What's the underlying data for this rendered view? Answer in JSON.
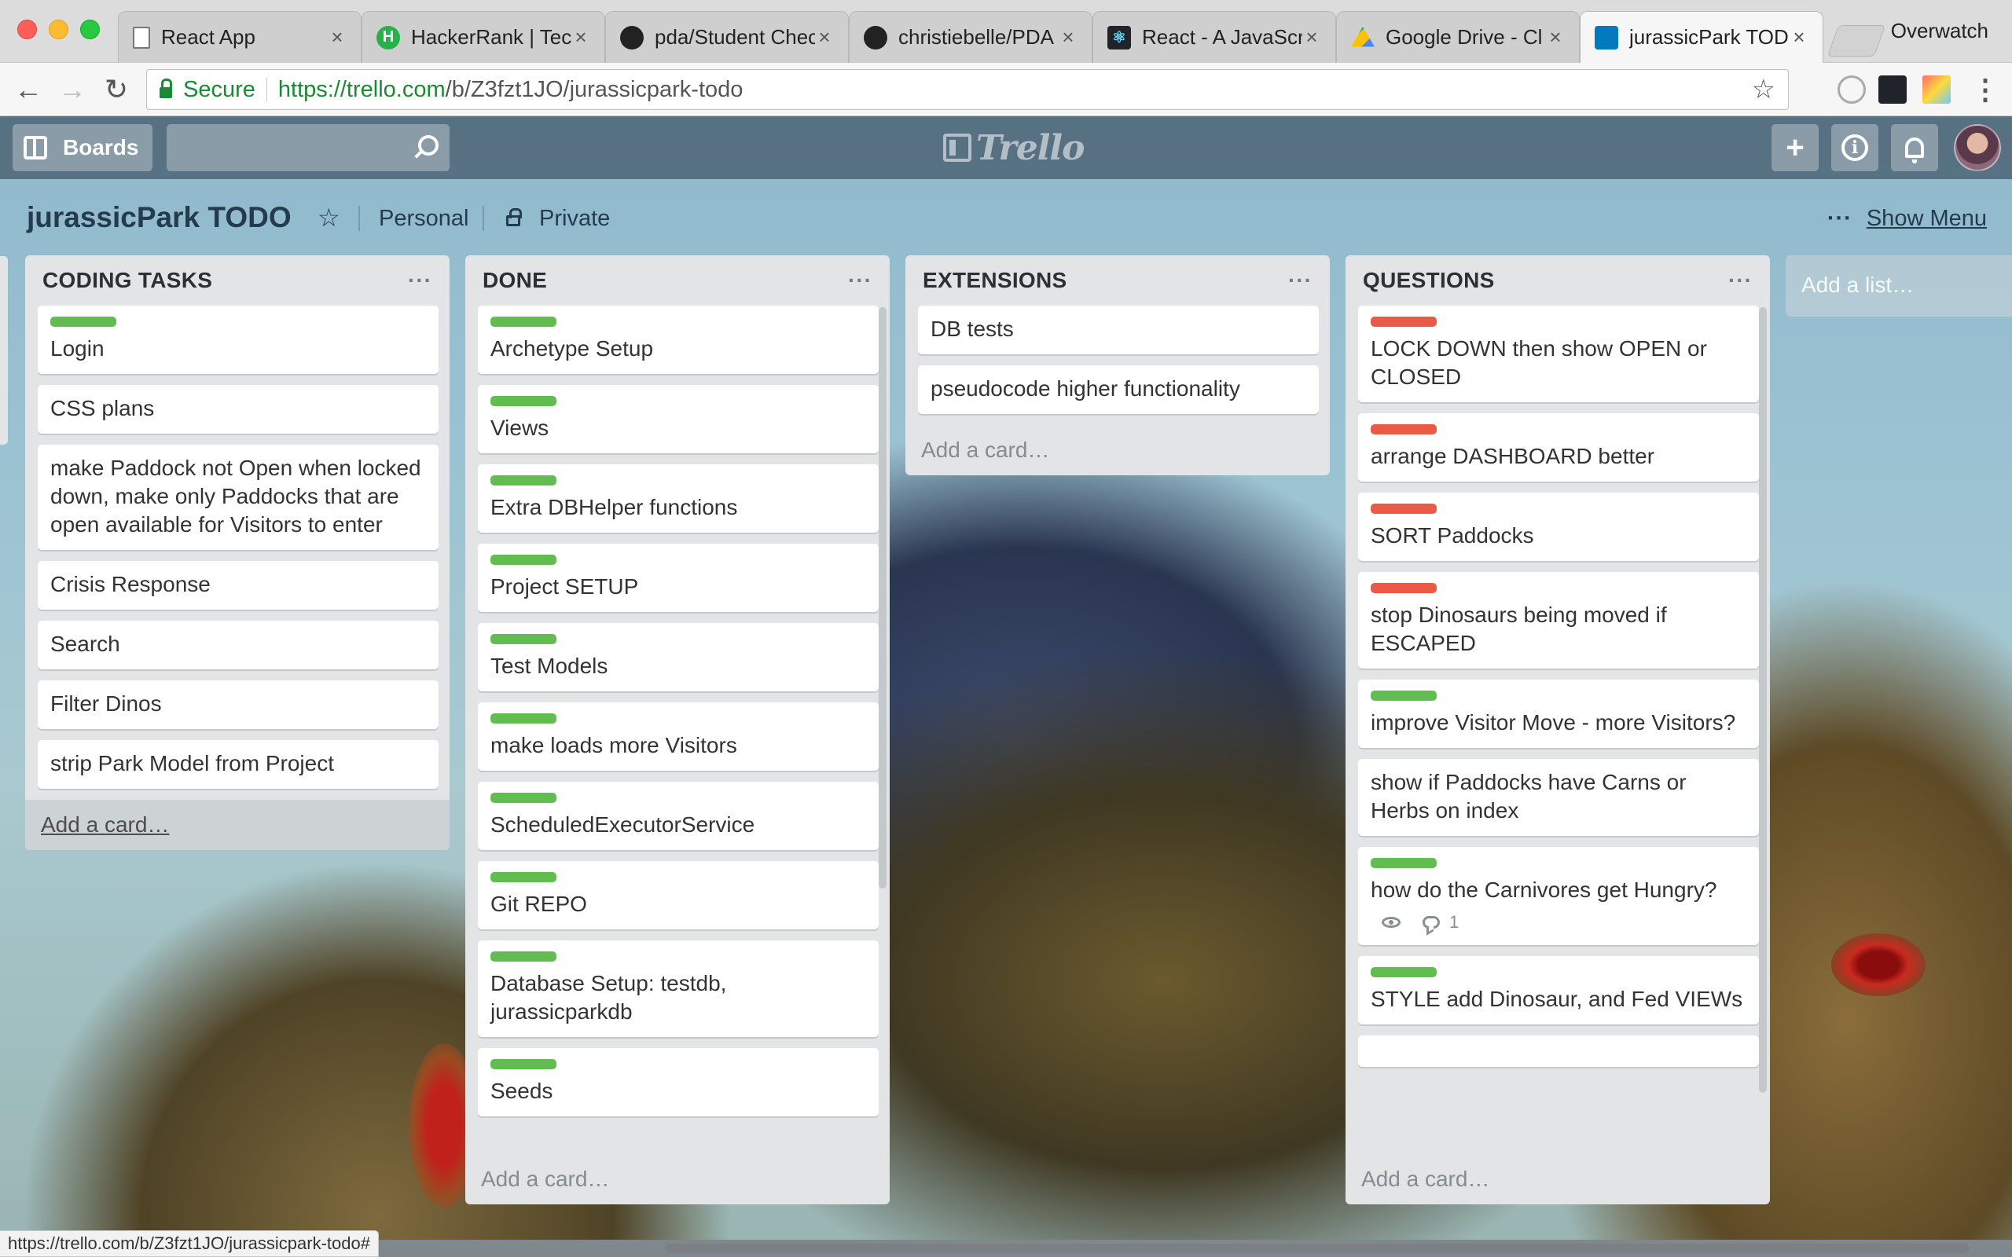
{
  "browser": {
    "tabs": [
      {
        "title": "React App",
        "icon": "document-icon"
      },
      {
        "title": "HackerRank | Tec",
        "icon": "hackerrank-icon",
        "badge": "H"
      },
      {
        "title": "pda/Student Chec",
        "icon": "github-icon"
      },
      {
        "title": "christiebelle/PDA",
        "icon": "github-icon"
      },
      {
        "title": "React - A JavaScr",
        "icon": "react-icon"
      },
      {
        "title": "Google Drive - Cl",
        "icon": "google-drive-icon"
      },
      {
        "title": "jurassicPark TOD",
        "icon": "trello-icon",
        "active": true
      }
    ],
    "profile": "Overwatch",
    "secure_label": "Secure",
    "url_host": "https://trello.com",
    "url_path": "/b/Z3fzt1JO/jurassicpark-todo",
    "status_url": "https://trello.com/b/Z3fzt1JO/jurassicpark-todo#"
  },
  "header": {
    "boards_label": "Boards",
    "logo_text": "Trello",
    "add_symbol": "+"
  },
  "board": {
    "title": "jurassicPark TODO",
    "team": "Personal",
    "visibility": "Private",
    "show_menu": "Show Menu",
    "menu_dots": "···"
  },
  "lists": [
    {
      "title": "CODING TASKS",
      "cards": [
        {
          "text": "Login",
          "label": "green"
        },
        {
          "text": "CSS plans"
        },
        {
          "text": "make Paddock not Open when locked down, make only Paddocks that are open available for Visitors to enter"
        },
        {
          "text": "Crisis Response"
        },
        {
          "text": "Search"
        },
        {
          "text": "Filter Dinos"
        },
        {
          "text": "strip Park Model from Project"
        }
      ],
      "add_card": "Add a card…"
    },
    {
      "title": "DONE",
      "cards": [
        {
          "text": "Archetype Setup",
          "label": "green"
        },
        {
          "text": "Views",
          "label": "green"
        },
        {
          "text": "Extra DBHelper functions",
          "label": "green"
        },
        {
          "text": "Project SETUP",
          "label": "green"
        },
        {
          "text": "Test Models",
          "label": "green"
        },
        {
          "text": "make loads more Visitors",
          "label": "green"
        },
        {
          "text": "ScheduledExecutorService",
          "label": "green"
        },
        {
          "text": "Git REPO",
          "label": "green"
        },
        {
          "text": "Database Setup: testdb, jurassicparkdb",
          "label": "green"
        },
        {
          "text": "Seeds",
          "label": "green"
        }
      ],
      "add_card": "Add a card…"
    },
    {
      "title": "EXTENSIONS",
      "cards": [
        {
          "text": "DB tests"
        },
        {
          "text": "pseudocode higher functionality"
        }
      ],
      "add_card": "Add a card…"
    },
    {
      "title": "QUESTIONS",
      "cards": [
        {
          "text": "LOCK DOWN then show OPEN or CLOSED",
          "label": "red"
        },
        {
          "text": "arrange DASHBOARD better",
          "label": "red"
        },
        {
          "text": "SORT Paddocks",
          "label": "red"
        },
        {
          "text": "stop Dinosaurs being moved if ESCAPED",
          "label": "red"
        },
        {
          "text": "improve Visitor Move - more Visitors?",
          "label": "green"
        },
        {
          "text": "show if Paddocks have Carns or Herbs on index"
        },
        {
          "text": "how do the Carnivores get Hungry?",
          "label": "green",
          "comments": "1"
        },
        {
          "text": "STYLE add Dinosaur, and Fed VIEWs",
          "label": "green"
        }
      ],
      "add_card": "Add a card…"
    }
  ],
  "add_list": "Add a list…",
  "colors": {
    "label_green": "#61bd4f",
    "label_red": "#eb5a46",
    "list_bg": "#e2e4e6",
    "secure_green": "#1a8a34"
  }
}
